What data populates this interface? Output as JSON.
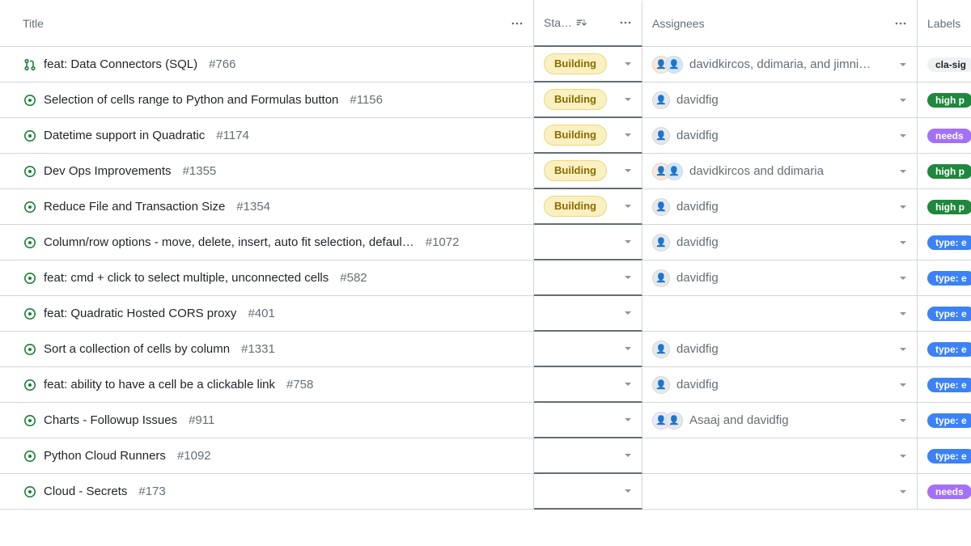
{
  "columns": {
    "title": "Title",
    "status": "Sta…",
    "assignees": "Assignees",
    "labels": "Labels"
  },
  "status_building": "Building",
  "rows": [
    {
      "icon": "pr",
      "title": "feat: Data Connectors (SQL)",
      "num": "#766",
      "status": "building",
      "avatars": [
        "a1",
        "a2"
      ],
      "assignees": "davidkircos, ddimaria, and jimni…",
      "label_text": "cla-sig",
      "label_class": "lbl-cla"
    },
    {
      "icon": "issue",
      "title": "Selection of cells range to Python and Formulas button",
      "num": "#1156",
      "status": "building",
      "avatars": [
        "a3"
      ],
      "assignees": "davidfig",
      "label_text": "high p",
      "label_class": "lbl-high"
    },
    {
      "icon": "issue",
      "title": "Datetime support in Quadratic",
      "num": "#1174",
      "status": "building",
      "avatars": [
        "a3"
      ],
      "assignees": "davidfig",
      "label_text": "needs",
      "label_class": "lbl-needs"
    },
    {
      "icon": "issue",
      "title": "Dev Ops Improvements",
      "num": "#1355",
      "status": "building",
      "avatars": [
        "a1",
        "a2"
      ],
      "assignees": "davidkircos and ddimaria",
      "label_text": "high p",
      "label_class": "lbl-high"
    },
    {
      "icon": "issue",
      "title": "Reduce File and Transaction Size",
      "num": "#1354",
      "status": "building",
      "avatars": [
        "a3"
      ],
      "assignees": "davidfig",
      "label_text": "high p",
      "label_class": "lbl-high"
    },
    {
      "icon": "issue",
      "title": "Column/row options - move, delete, insert, auto fit selection, defaul…",
      "num": "#1072",
      "status": "",
      "avatars": [
        "a3"
      ],
      "assignees": "davidfig",
      "label_text": "type: e",
      "label_class": "lbl-type"
    },
    {
      "icon": "issue",
      "title": "feat: cmd + click to select multiple, unconnected cells",
      "num": "#582",
      "status": "",
      "avatars": [
        "a3"
      ],
      "assignees": "davidfig",
      "label_text": "type: e",
      "label_class": "lbl-type"
    },
    {
      "icon": "issue",
      "title": "feat: Quadratic Hosted CORS proxy",
      "num": "#401",
      "status": "",
      "avatars": [],
      "assignees": "",
      "label_text": "type: e",
      "label_class": "lbl-type"
    },
    {
      "icon": "issue",
      "title": "Sort a collection of cells by column",
      "num": "#1331",
      "status": "",
      "avatars": [
        "a3"
      ],
      "assignees": "davidfig",
      "label_text": "type: e",
      "label_class": "lbl-type"
    },
    {
      "icon": "issue",
      "title": "feat: ability to have a cell be a clickable link",
      "num": "#758",
      "status": "",
      "avatars": [
        "a3"
      ],
      "assignees": "davidfig",
      "label_text": "type: e",
      "label_class": "lbl-type"
    },
    {
      "icon": "issue",
      "title": "Charts - Followup Issues",
      "num": "#911",
      "status": "",
      "avatars": [
        "a4",
        "a3"
      ],
      "assignees": "Asaaj and davidfig",
      "label_text": "type: e",
      "label_class": "lbl-type"
    },
    {
      "icon": "issue",
      "title": "Python Cloud Runners",
      "num": "#1092",
      "status": "",
      "avatars": [],
      "assignees": "",
      "label_text": "type: e",
      "label_class": "lbl-type"
    },
    {
      "icon": "issue",
      "title": "Cloud - Secrets",
      "num": "#173",
      "status": "",
      "avatars": [],
      "assignees": "",
      "label_text": "needs",
      "label_class": "lbl-needs"
    }
  ]
}
